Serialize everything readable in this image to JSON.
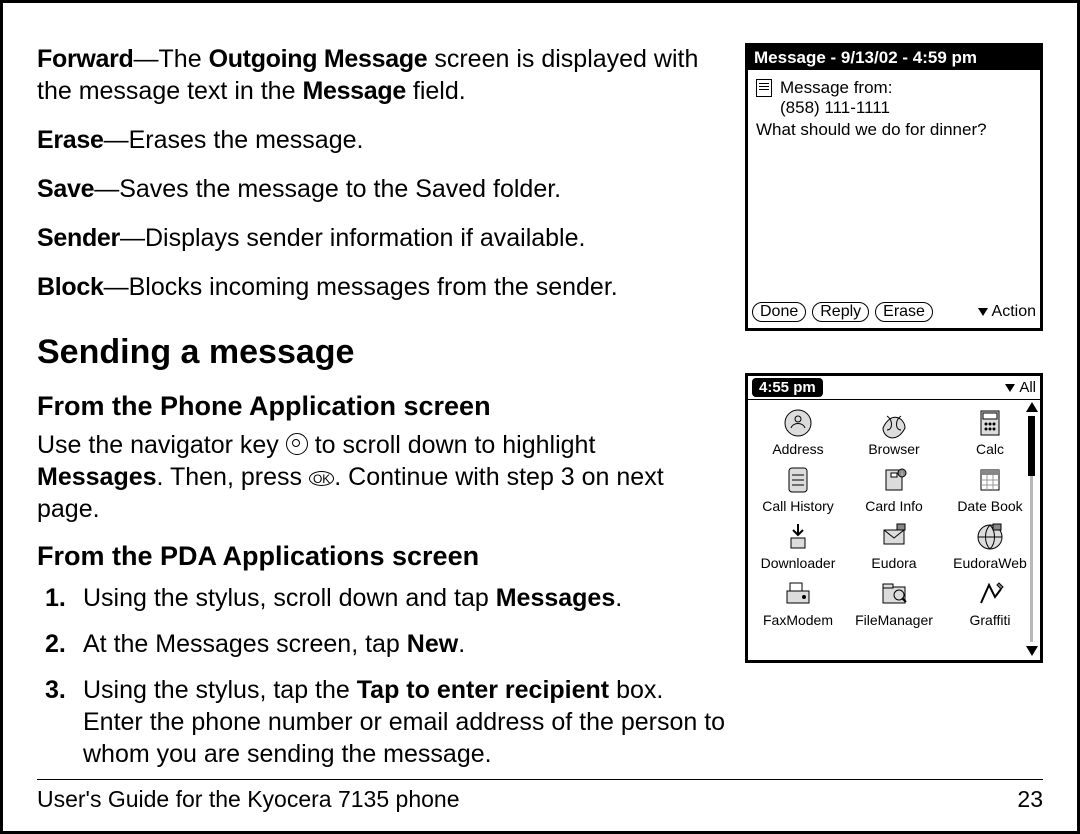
{
  "defs": {
    "forward_lead": "Forward",
    "forward_bold": "Outgoing Message",
    "forward_tail1": " screen is displayed with the message text in the ",
    "forward_bold2": "Message",
    "forward_tail2": " field.",
    "erase_lead": "Erase",
    "erase_text": "—Erases the message.",
    "save_lead": "Save",
    "save_text": "—Saves the message to the Saved folder.",
    "sender_lead": "Sender",
    "sender_text": "—Displays sender information if available.",
    "block_lead": "Block",
    "block_text": "—Blocks incoming messages from the sender."
  },
  "heading": "Sending a message",
  "sub1": "From the Phone Application screen",
  "phone_para_a": "Use the navigator key ",
  "phone_para_b": " to scroll down to highlight ",
  "phone_bold": "Messages",
  "phone_para_c": ". Then, press ",
  "phone_para_d": ". Continue with step 3 on next page.",
  "sub2": "From the PDA Applications screen",
  "steps": {
    "n1": "1.",
    "s1a": "Using the stylus, scroll down and tap ",
    "s1b": "Messages",
    "s1c": ".",
    "n2": "2.",
    "s2a": "At the Messages screen, tap ",
    "s2b": "New",
    "s2c": ".",
    "n3": "3.",
    "s3a": "Using the stylus, tap the ",
    "s3b": "Tap to enter recipient",
    "s3c": " box. Enter the phone number or email address of the person to whom you are sending the message."
  },
  "footer": {
    "left": "User's Guide for the Kyocera 7135 phone",
    "right": "23"
  },
  "shot1": {
    "title": "Message - 9/13/02 - 4:59 pm",
    "from_label": "Message from:",
    "from_number": "(858)  111-1111",
    "body": "What should we do for dinner?",
    "btn_done": "Done",
    "btn_reply": "Reply",
    "btn_erase": "Erase",
    "action": "Action"
  },
  "shot2": {
    "time": "4:55 pm",
    "filter": "All",
    "apps": [
      "Address",
      "Browser",
      "Calc",
      "Call History",
      "Card Info",
      "Date Book",
      "Downloader",
      "Eudora",
      "EudoraWeb",
      "FaxModem",
      "FileManager",
      "Graffiti"
    ]
  }
}
